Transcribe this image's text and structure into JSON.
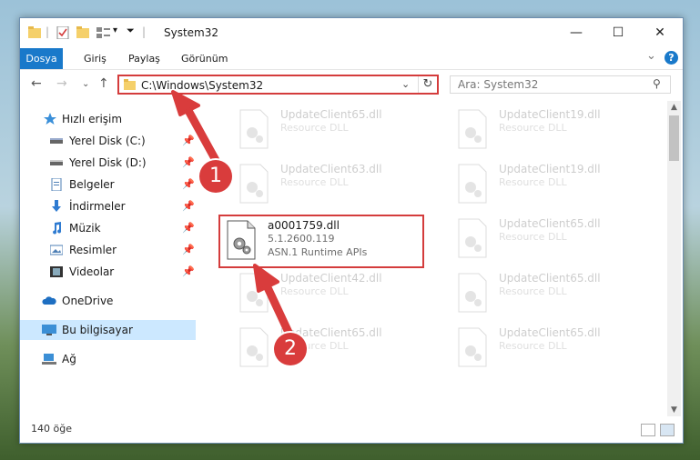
{
  "window": {
    "title": "System32",
    "controls": {
      "minimize": "—",
      "maximize": "☐",
      "close": "✕"
    }
  },
  "ribbon": {
    "tabs": [
      "Dosya",
      "Giriş",
      "Paylaş",
      "Görünüm"
    ],
    "expand": "⌄",
    "help": "?"
  },
  "nav": {
    "back": "←",
    "forward": "→",
    "recent": "⌄",
    "up": "↑",
    "address": "C:\\Windows\\System32",
    "search_placeholder": "Ara: System32"
  },
  "sidebar": {
    "items": [
      {
        "label": "Hızlı erişim",
        "icon": "star-icon"
      },
      {
        "label": "Yerel Disk (C:)",
        "icon": "drive-icon",
        "pinned": true
      },
      {
        "label": "Yerel Disk (D:)",
        "icon": "drive-icon",
        "pinned": true
      },
      {
        "label": "Belgeler",
        "icon": "documents-icon",
        "pinned": true
      },
      {
        "label": "İndirmeler",
        "icon": "download-icon",
        "pinned": true
      },
      {
        "label": "Müzik",
        "icon": "music-icon",
        "pinned": true
      },
      {
        "label": "Resimler",
        "icon": "pictures-icon",
        "pinned": true
      },
      {
        "label": "Videolar",
        "icon": "video-icon",
        "pinned": true
      },
      {
        "label": "OneDrive",
        "icon": "cloud-icon"
      },
      {
        "label": "Bu bilgisayar",
        "icon": "computer-icon",
        "selected": true
      },
      {
        "label": "Ağ",
        "icon": "network-icon"
      }
    ]
  },
  "files": {
    "highlighted": {
      "name": "a0001759.dll",
      "version": "5.1.2600.119",
      "description": "ASN.1 Runtime APIs"
    },
    "left_column": [
      {
        "name": "UpdateClient65.dll",
        "type": "Resource DLL"
      },
      {
        "name": "UpdateClient63.dll",
        "type": "Resource DLL"
      },
      {
        "name": "UpdateClient42.dll",
        "type": "Resource DLL"
      },
      {
        "name": "UpdateClient65.dll",
        "type": "Resource DLL"
      }
    ],
    "right_column": [
      {
        "name": "UpdateClient19.dll",
        "type": "Resource DLL"
      },
      {
        "name": "UpdateClient19.dll",
        "type": "Resource DLL"
      },
      {
        "name": "UpdateClient65.dll",
        "type": "Resource DLL"
      },
      {
        "name": "UpdateClient65.dll",
        "type": "Resource DLL"
      },
      {
        "name": "UpdateClient65.dll",
        "type": "Resource DLL"
      }
    ]
  },
  "status": {
    "count": "140 öğe"
  },
  "annotations": {
    "step1": "1",
    "step2": "2"
  },
  "colors": {
    "accent": "#1979ca",
    "highlight": "#d43c3c",
    "selected": "#cce8ff"
  }
}
